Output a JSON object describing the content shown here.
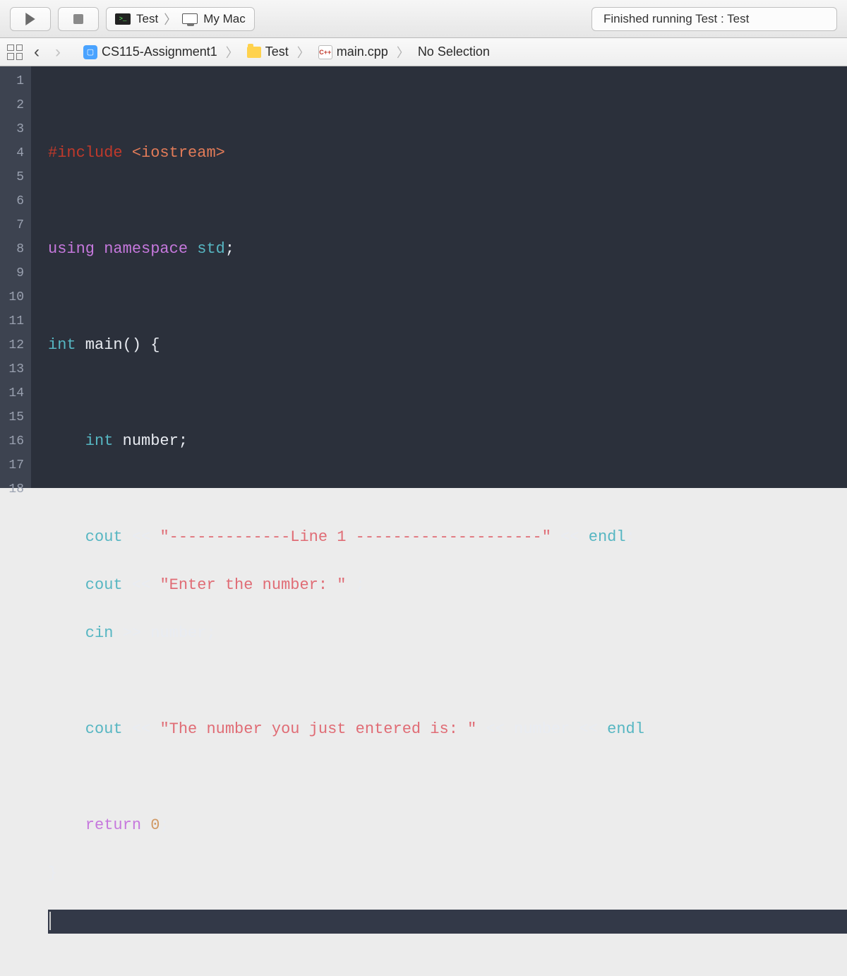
{
  "toolbar": {
    "scheme_target": "Test",
    "scheme_device": "My Mac",
    "status": "Finished running Test : Test"
  },
  "jumpbar": {
    "project": "CS115-Assignment1",
    "folder": "Test",
    "file": "main.cpp",
    "selection": "No Selection"
  },
  "gutter": [
    "1",
    "2",
    "3",
    "4",
    "5",
    "6",
    "7",
    "8",
    "9",
    "10",
    "11",
    "12",
    "13",
    "14",
    "15",
    "16",
    "17",
    "18"
  ],
  "code": {
    "l1": "",
    "l2_a": "#include",
    "l2_b": " <iostream>",
    "l3": "",
    "l4_a": "using",
    "l4_b": " namespace",
    "l4_c": " std",
    "l4_d": ";",
    "l5": "",
    "l6_a": "int",
    "l6_b": " main",
    "l6_c": "() {",
    "l7": "",
    "l8_a": "    int",
    "l8_b": " number",
    "l8_c": ";",
    "l9": "",
    "l10_a": "    cout ",
    "l10_b": "<< ",
    "l10_c": "\"-------------Line 1 --------------------\"",
    "l10_d": " << ",
    "l10_e": "endl",
    "l10_f": ";",
    "l11_a": "    cout ",
    "l11_b": "<< ",
    "l11_c": "\"Enter the number: \"",
    "l11_d": " ;",
    "l12_a": "    cin ",
    "l12_b": ">> ",
    "l12_c": "number",
    "l12_d": ";",
    "l13": "",
    "l14_a": "    cout ",
    "l14_b": "<< ",
    "l14_c": "\"The number you just entered is: \"",
    "l14_d": " << ",
    "l14_e": "number",
    "l14_f": " << ",
    "l14_g": "endl",
    "l14_h": ";",
    "l15": "",
    "l16_a": "    return",
    "l16_b": " 0",
    "l16_c": ";",
    "l17": "}",
    "l18": ""
  }
}
